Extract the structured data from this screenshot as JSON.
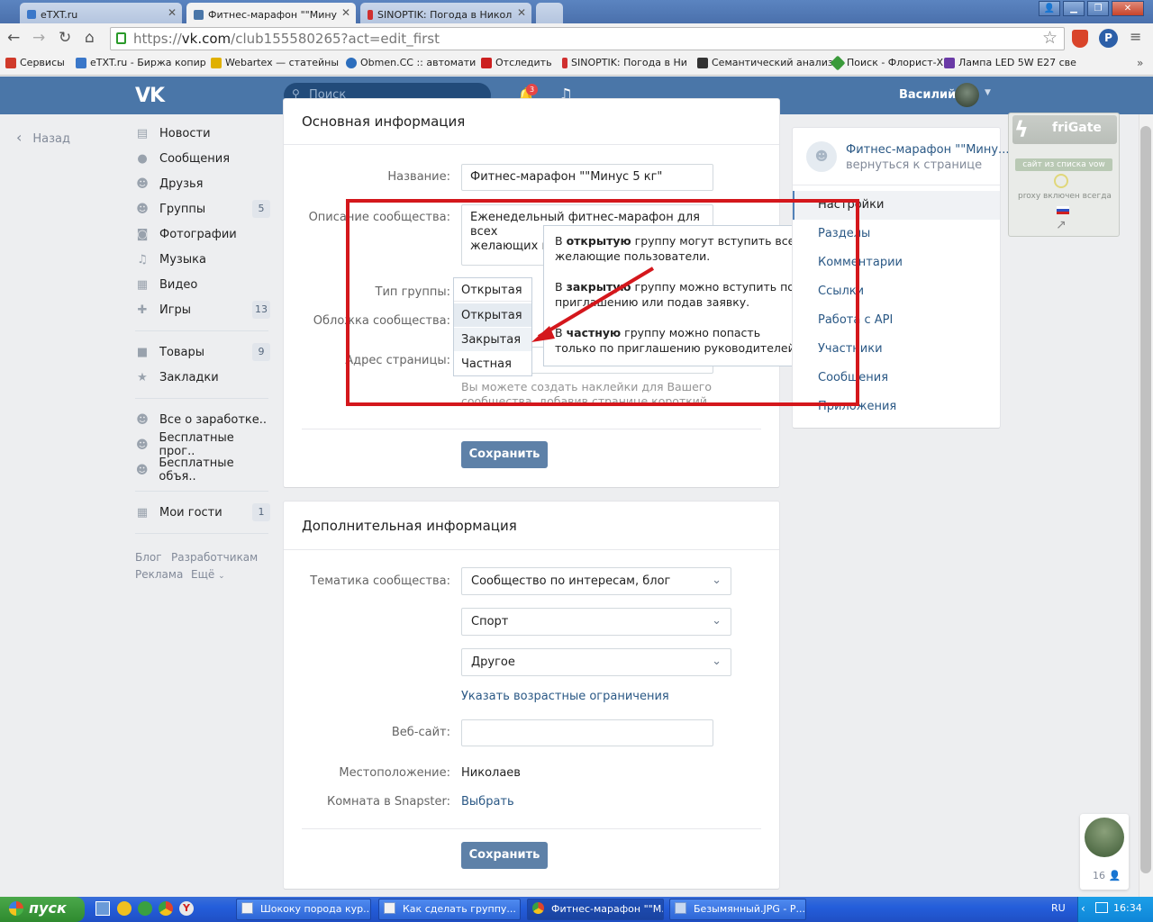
{
  "browser": {
    "tabs": [
      {
        "label": "eTXT.ru"
      },
      {
        "label": "Фитнес-марафон \"\"Мину"
      },
      {
        "label": "SINOPTIK: Погода в Никол"
      }
    ],
    "address": {
      "scheme": "https://",
      "host": "vk.com",
      "path": "/club155580265?act=edit_first"
    },
    "bookmarks": [
      {
        "label": "Сервисы",
        "color": "#d03a2a"
      },
      {
        "label": "eTXT.ru - Биржа копир",
        "color": "#3a77c9"
      },
      {
        "label": "Webartex — статейны",
        "color": "#e0b000"
      },
      {
        "label": "Obmen.CC :: автомати",
        "color": "#2c6ebd"
      },
      {
        "label": "Отследить",
        "color": "#cc2020"
      },
      {
        "label": "SINOPTIK: Погода в Ни",
        "color": "#d03030"
      },
      {
        "label": "Семантический анализ",
        "color": "#333333"
      },
      {
        "label": "Поиск - Флорист-Х",
        "color": "#3a9a3a"
      },
      {
        "label": "Лампа LED 5W E27 све",
        "color": "#6a3aa6"
      }
    ]
  },
  "header": {
    "search_placeholder": "Поиск",
    "notifications_count": "3",
    "user_name": "Василий",
    "accent": "#4a76a8"
  },
  "nav": {
    "back": "Назад",
    "items": [
      {
        "label": "Новости",
        "icon": "news-icon",
        "count": ""
      },
      {
        "label": "Сообщения",
        "icon": "messages-icon",
        "count": ""
      },
      {
        "label": "Друзья",
        "icon": "friends-icon",
        "count": ""
      },
      {
        "label": "Группы",
        "icon": "groups-icon",
        "count": "5"
      },
      {
        "label": "Фотографии",
        "icon": "camera-icon",
        "count": ""
      },
      {
        "label": "Музыка",
        "icon": "music-icon",
        "count": ""
      },
      {
        "label": "Видео",
        "icon": "video-icon",
        "count": ""
      },
      {
        "label": "Игры",
        "icon": "gamepad-icon",
        "count": "13"
      },
      {
        "label": "Товары",
        "icon": "bag-icon",
        "count": "9"
      },
      {
        "label": "Закладки",
        "icon": "star-icon",
        "count": ""
      },
      {
        "label": "Все о заработке..",
        "icon": "group-icon",
        "count": ""
      },
      {
        "label": "Бесплатные прог..",
        "icon": "group-icon",
        "count": ""
      },
      {
        "label": "Бесплатные объя..",
        "icon": "group-icon",
        "count": ""
      },
      {
        "label": "Мои гости",
        "icon": "grid-icon",
        "count": "1"
      }
    ],
    "footer": {
      "blog": "Блог",
      "dev": "Разработчикам",
      "ads": "Реклама",
      "more": "Ещё"
    }
  },
  "main": {
    "section1": {
      "title": "Основная информация",
      "name_label": "Название:",
      "name_value": "Фитнес-марафон \"\"Минус 5 кг\"",
      "desc_label": "Описание сообщества:",
      "desc_value_line1": "Еженедельный фитнес-марафон для всех",
      "desc_value_line2": "желающих и",
      "type_label": "Тип группы:",
      "type_value": "Открытая",
      "type_options": [
        "Открытая",
        "Закрытая",
        "Частная"
      ],
      "cover_label": "Обложка сообщества:",
      "address_label": "Адрес страницы:",
      "address_hint_line1": "Вы можете создать наклейки для Вашего",
      "address_hint_line2": "сообщества, добавив странице короткий адрес",
      "save": "Сохранить"
    },
    "tooltip": {
      "p1_pre": "В ",
      "p1_bold": "открытую",
      "p1_post": " группу могут вступить все желающие пользователи.",
      "p2_pre": "В ",
      "p2_bold": "закрытую",
      "p2_post": " группу можно вступить по приглашению или подав заявку.",
      "p3_pre": "В ",
      "p3_bold": "частную",
      "p3_post": " группу можно попасть только по приглашению руководителей."
    },
    "section2": {
      "title": "Дополнительная информация",
      "theme_label": "Тематика сообщества:",
      "theme_value": "Сообщество по интересам, блог",
      "sub1": "Спорт",
      "sub2": "Другое",
      "age_link": "Указать возрастные ограничения",
      "website_label": "Веб-сайт:",
      "location_label": "Местоположение:",
      "location_value": "Николаев",
      "snapster_label": "Комната в Snapster:",
      "snapster_value": "Выбрать",
      "save": "Сохранить"
    }
  },
  "right": {
    "group_name": "Фитнес-марафон \"\"Мину...",
    "back_link": "вернуться к странице",
    "menu": [
      "Настройки",
      "Разделы",
      "Комментарии",
      "Ссылки",
      "Работа с API",
      "Участники",
      "Сообщения",
      "Приложения"
    ]
  },
  "frigate": {
    "title": "friGate",
    "list_btn": "сайт из списка vow",
    "status": "proxy включен всегда"
  },
  "chat": {
    "count": "16"
  },
  "taskbar": {
    "start": "пуск",
    "windows": [
      "Шококу порода кур...",
      "Как сделать группу...",
      "Фитнес-марафон \"\"М...",
      "Безымянный.JPG - Р..."
    ],
    "lang": "RU",
    "time": "16:34"
  }
}
